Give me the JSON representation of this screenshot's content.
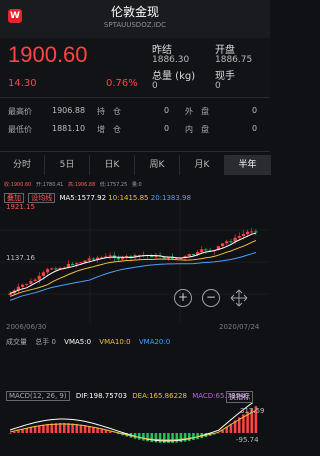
{
  "header": {
    "title": "伦敦金现",
    "subtitle": "SPTAUUSDOZ.IDC"
  },
  "quote": {
    "price": "1900.60",
    "change": "14.30",
    "change_pct": "0.76%",
    "stats": [
      {
        "label": "昨结",
        "value": "1886.30"
      },
      {
        "label": "开盘",
        "value": "1886.75"
      },
      {
        "label": "总量 (kg)",
        "value": "0"
      },
      {
        "label": "现手",
        "value": "0"
      }
    ]
  },
  "rows": [
    {
      "l1": "最高价",
      "v1": "1906.88",
      "l2": "持　仓",
      "v2": "0",
      "l3": "外　盘",
      "v3": "0"
    },
    {
      "l1": "最低价",
      "v1": "1881.10",
      "l2": "增　仓",
      "v2": "0",
      "l3": "内　盘",
      "v3": "0"
    }
  ],
  "tabs": [
    "分时",
    "5日",
    "日K",
    "周K",
    "月K",
    "半年"
  ],
  "active_tab": "半年",
  "chart_info": {
    "line": [
      "收:1900.60",
      "开:1780.41",
      "高:1906.88",
      "低:1757.25",
      "量:0",
      "",
      ""
    ],
    "chips": [
      "叠加",
      "设均线"
    ],
    "ma5": "MA5:1577.92",
    "ma10": "10:1415.85",
    "ma20": "20:1383.98",
    "high_label": "1921.15",
    "mid_label": "1137.16",
    "date_left": "2006/06/30",
    "date_right": "2020/07/24"
  },
  "volume": {
    "label": "成交量",
    "total": "总手 0",
    "vma5": "VMA5:0",
    "vma10": "VMA10:0",
    "vma20": "VMA20:0"
  },
  "macd": {
    "label": "MACD(12, 26, 9)",
    "dif": "DIF:198.75703",
    "dea": "DEA:165.86228",
    "macd": "MACD:65.78949",
    "switch": "换指标",
    "top_value": "317.59",
    "bottom_value": "-95.74"
  },
  "chart_data": {
    "type": "candlestick",
    "x_range": [
      "2006/06/30",
      "2020/07/24"
    ],
    "y_labels": [
      "1921.15",
      "1137.16"
    ],
    "series": [
      {
        "name": "MA5",
        "value": 1577.92
      },
      {
        "name": "MA10",
        "value": 1415.85
      },
      {
        "name": "MA20",
        "value": 1383.98
      }
    ],
    "macd_series": [
      {
        "name": "DIF",
        "value": 198.75703
      },
      {
        "name": "DEA",
        "value": 165.86228
      },
      {
        "name": "MACD",
        "value": 65.78949
      }
    ]
  },
  "colors": {
    "up": "#ff4444",
    "down": "#20c060",
    "ma5": "#ffffff",
    "ma10": "#f0c040",
    "ma20": "#4aa0ff"
  }
}
